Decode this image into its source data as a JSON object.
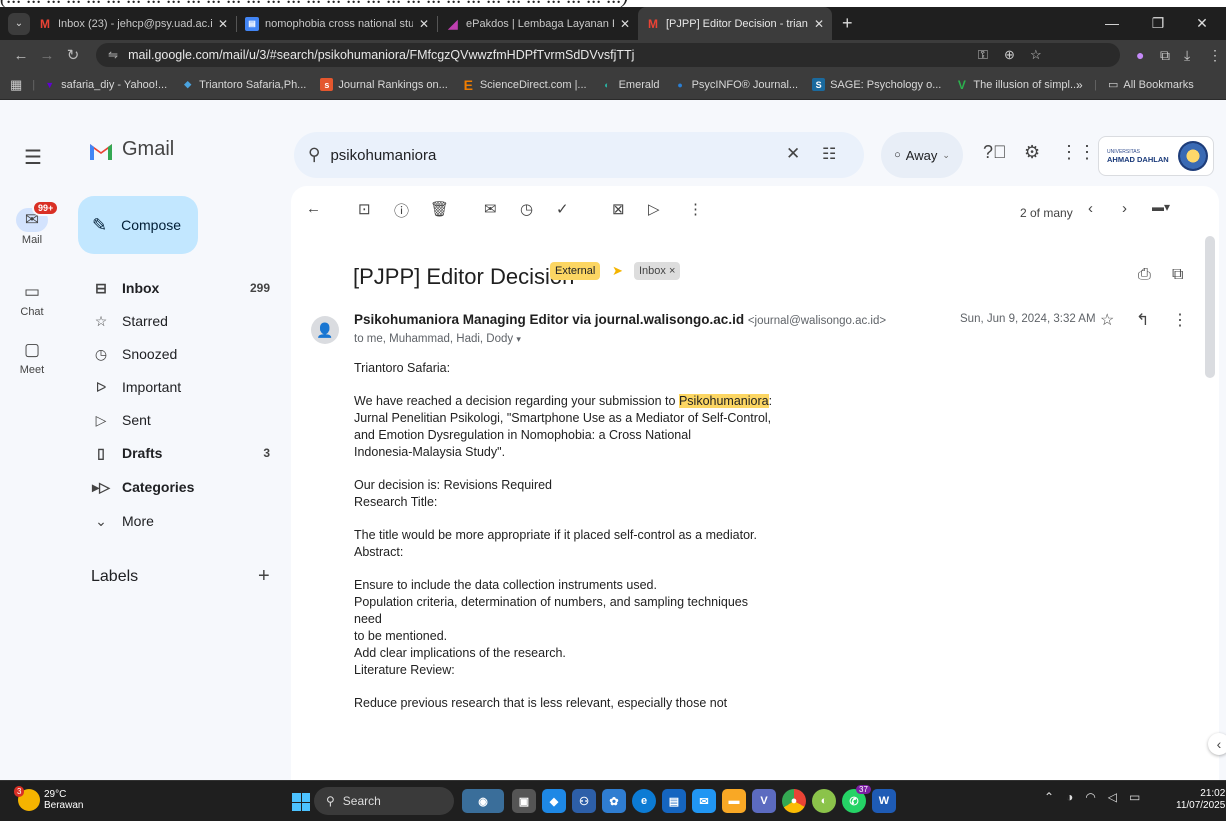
{
  "window": {
    "top_strip_text": "(... ... ... ... ... ... ... ... ... ... ... ... ... ... ... ... ... ... ... ... ... ... ... ... ... ... ... ... ... ... ...)"
  },
  "browser": {
    "tabs": [
      {
        "title": "Inbox (23) - jehcp@psy.uad.ac.i",
        "icon": "gmail-icon",
        "active": false
      },
      {
        "title": "nomophobia cross national stu",
        "icon": "docs-icon",
        "active": false
      },
      {
        "title": "ePakdos | Lembaga Layanan Pe",
        "icon": "epakdos-icon",
        "active": false
      },
      {
        "title": "[PJPP] Editor Decision - trianton",
        "icon": "gmail-icon",
        "active": true
      }
    ],
    "url": "mail.google.com/mail/u/3/#search/psikohumaniora/FMfcgzQVwwzfmHDPfTvrmSdDVvsfjTTj",
    "bookmarks": [
      "safaria_diy - Yahoo!...",
      "Triantoro Safaria,Ph...",
      "Journal Rankings on...",
      "ScienceDirect.com |...",
      "Emerald",
      "PsycINFO® Journal...",
      "SAGE: Psychology o...",
      "The illusion of simpl..."
    ],
    "bookmarks_more": "»",
    "all_bookmarks": "All Bookmarks"
  },
  "gmail": {
    "logo_text": "Gmail",
    "search_value": "psikohumaniora",
    "status": "Away",
    "org_small": "UNIVERSITAS",
    "org_name": "AHMAD DAHLAN",
    "rail": {
      "mail": "Mail",
      "chat": "Chat",
      "meet": "Meet",
      "mail_badge": "99+"
    },
    "compose": "Compose",
    "nav": [
      {
        "label": "Inbox",
        "count": "299",
        "bold": true,
        "icon": "inbox-icon"
      },
      {
        "label": "Starred",
        "count": "",
        "bold": false,
        "icon": "star-icon"
      },
      {
        "label": "Snoozed",
        "count": "",
        "bold": false,
        "icon": "clock-icon"
      },
      {
        "label": "Important",
        "count": "",
        "bold": false,
        "icon": "important-icon"
      },
      {
        "label": "Sent",
        "count": "",
        "bold": false,
        "icon": "send-icon"
      },
      {
        "label": "Drafts",
        "count": "3",
        "bold": true,
        "icon": "draft-icon"
      },
      {
        "label": "Categories",
        "count": "",
        "bold": true,
        "icon": "label-icon"
      },
      {
        "label": "More",
        "count": "",
        "bold": false,
        "icon": "chevron-down-icon"
      }
    ],
    "labels_title": "Labels",
    "pager": "2 of many",
    "message": {
      "subject": "[PJPP] Editor Decision",
      "external_badge": "External",
      "inbox_chip": "Inbox ×",
      "sender_name": "Psikohumaniora Managing Editor via journal.walisongo.ac.id",
      "sender_email": "<journal@walisongo.ac.id>",
      "to": "to me, Muhammad, Hadi, Dody",
      "date": "Sun, Jun 9, 2024, 3:32 AM",
      "greeting": "Triantoro Safaria:",
      "p1_before": "We have reached a decision regarding your submission to ",
      "p1_highlight": "Psikohumaniora",
      "p1_line1_end": ":",
      "p1_line2": "Jurnal Penelitian Psikologi, \"Smartphone Use as a Mediator of Self-Control,",
      "p1_line3": "and Emotion Dysregulation in Nomophobia: a Cross National",
      "p1_line4": "Indonesia-Malaysia Study\".",
      "decision_line": "Our decision is: Revisions Required",
      "research_title_heading": "Research Title:",
      "title_comment": "The title would be more appropriate if it placed self-control as a mediator.",
      "abstract_heading": "Abstract:",
      "abs_1": "Ensure to include the data collection instruments used.",
      "abs_2": "Population criteria, determination of numbers, and sampling techniques need",
      "abs_3": "to be mentioned.",
      "abs_4": "Add clear implications of the research.",
      "lit_heading": "Literature Review:",
      "lit_1": "Reduce previous research that is less relevant, especially those not"
    }
  },
  "taskbar": {
    "temp": "29°C",
    "weather": "Berawan",
    "weather_badge": "3",
    "search": "Search",
    "time": "21:02",
    "date": "11/07/2025",
    "whatsapp_badge": "37"
  }
}
